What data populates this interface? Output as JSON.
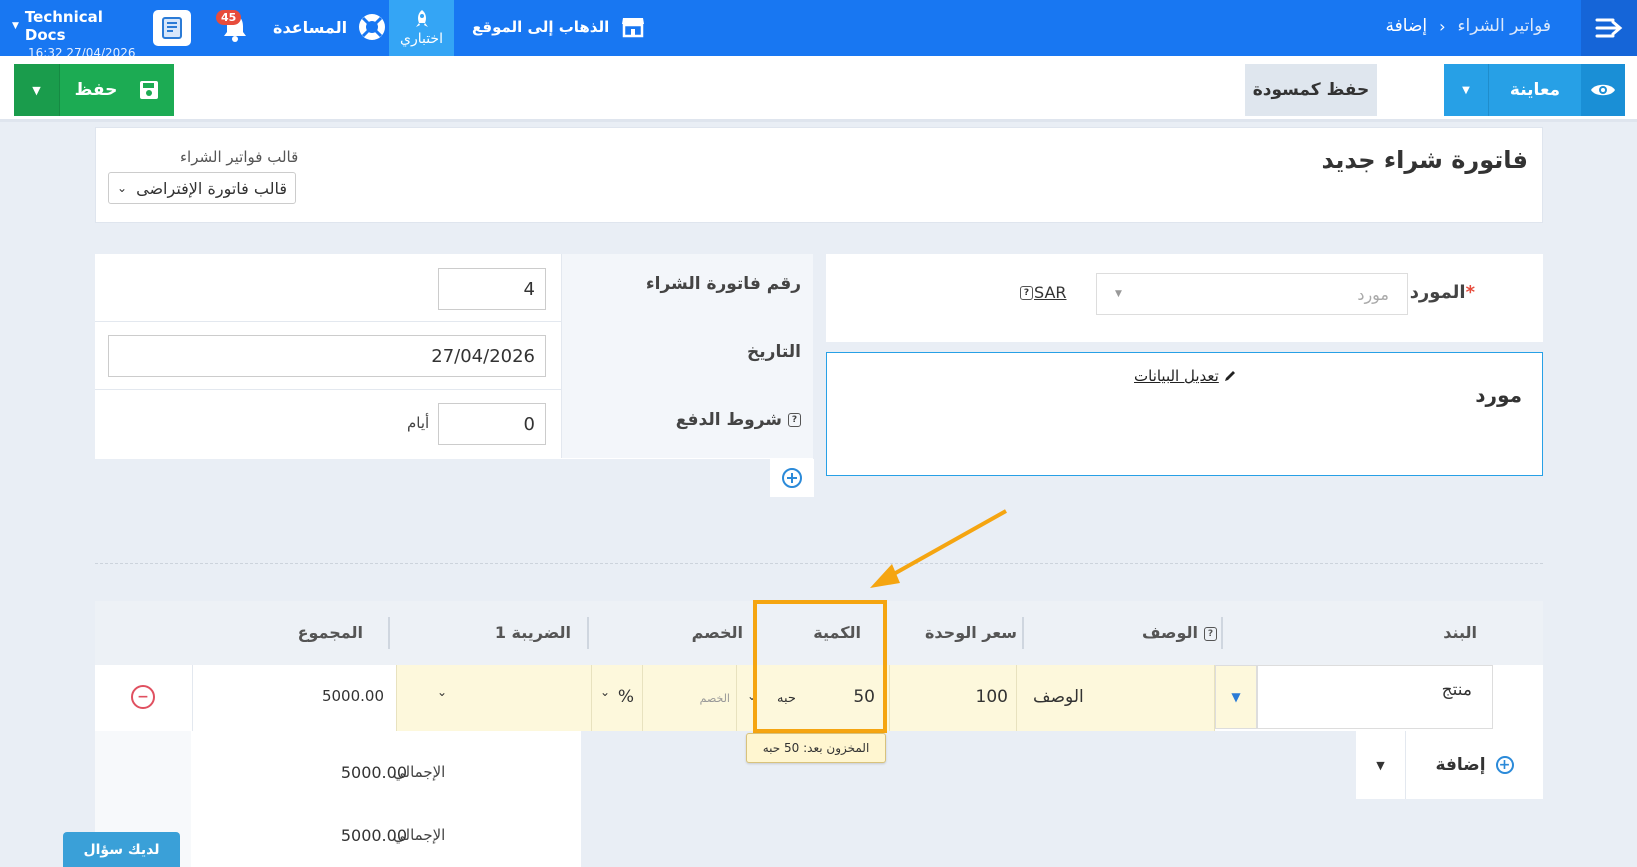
{
  "topbar": {
    "breadcrumb": [
      "فواتير الشراء",
      "إضافة"
    ],
    "user_name": "Technical Docs",
    "user_time": "16:32 27/04/2026",
    "notifications_count": "45",
    "help_label": "المساعدة",
    "try_label": "اختباري",
    "goto_site_label": "الذهاب إلى الموقع",
    "brand_color": "#1877f2"
  },
  "actions": {
    "save_label": "حفظ",
    "draft_label": "حفظ كمسودة",
    "preview_label": "معاينة"
  },
  "header": {
    "title": "فاتورة شراء جديد",
    "template_label": "قالب فواتير الشراء",
    "template_value": "قالب فاتورة الإفتراضى"
  },
  "form": {
    "invoice_number_label": "رقم فاتورة الشراء",
    "invoice_number": "4",
    "date_label": "التاريخ",
    "date": "27/04/2026",
    "payment_terms_label": "شروط الدفع",
    "payment_terms": "0",
    "days_label": "أيام"
  },
  "supplier": {
    "label": "المورد",
    "required_mark": "*",
    "placeholder": "مورد",
    "currency": "SAR",
    "box_name": "مورد",
    "edit_label": "تعديل البيانات"
  },
  "items": {
    "headers": {
      "item": "البند",
      "description": "الوصف",
      "unit_price": "سعر الوحدة",
      "quantity": "الكمية",
      "discount": "الخصم",
      "tax": "الضريبة 1",
      "total": "المجموع"
    },
    "row": {
      "product": "منتج",
      "description": "الوصف",
      "unit_price": "100",
      "quantity": "50",
      "unit": "حبه",
      "discount_placeholder": "الخصم",
      "discount_type": "%",
      "total": "5000.00"
    },
    "stock_tooltip": "المخزون بعد: 50 حبه",
    "add_label": "إضافة"
  },
  "totals": {
    "rows": [
      {
        "label": "الإجمالي",
        "value": "5000.00"
      },
      {
        "label": "الإجمالي",
        "value": "5000.00"
      }
    ]
  },
  "help_widget": {
    "label": "لديك سؤال"
  },
  "annotation_color": "#f5a511"
}
